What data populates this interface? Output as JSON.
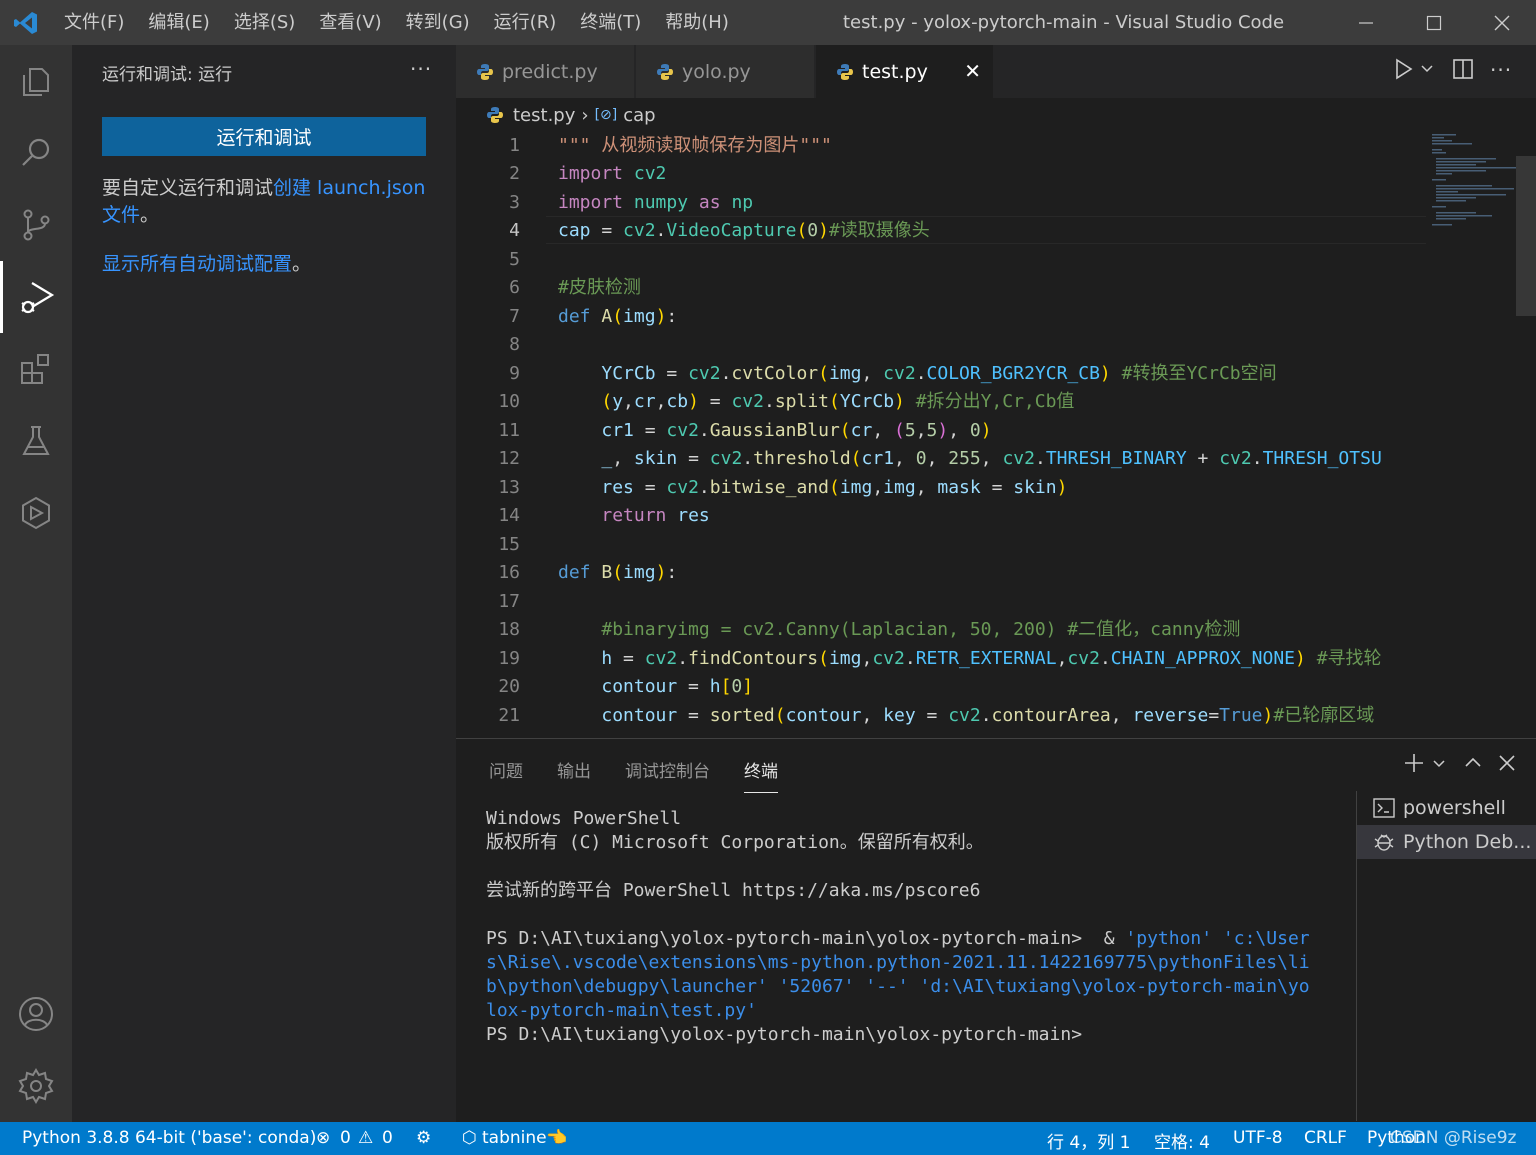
{
  "titlebar": {
    "menu": [
      "文件(F)",
      "编辑(E)",
      "选择(S)",
      "查看(V)",
      "转到(G)",
      "运行(R)",
      "终端(T)",
      "帮助(H)"
    ],
    "window_title": "test.py - yolox-pytorch-main - Visual Studio Code"
  },
  "sidebar": {
    "header": "运行和调试: 运行",
    "run_button": "运行和调试",
    "para_prefix": "要自定义运行和调试",
    "para_link": "创建 launch.json",
    "para_link2": "文件",
    "para_suffix": "。",
    "show_all": "显示所有自动调试配置",
    "show_all_suffix": "。"
  },
  "tabs": [
    {
      "label": "predict.py"
    },
    {
      "label": "yolo.py"
    },
    {
      "label": "test.py"
    }
  ],
  "breadcrumb": {
    "file": "test.py",
    "symbol": "cap"
  },
  "editor": {
    "current_line": 4,
    "line_numbers": [
      "1",
      "2",
      "3",
      "4",
      "5",
      "6",
      "7",
      "8",
      "9",
      "10",
      "11",
      "12",
      "13",
      "14",
      "15",
      "16",
      "17",
      "18",
      "19",
      "20",
      "21"
    ]
  },
  "panel": {
    "tabs": [
      "问题",
      "输出",
      "调试控制台",
      "终端"
    ],
    "terminal": {
      "l1": "Windows PowerShell",
      "l2": "版权所有 (C) Microsoft Corporation。保留所有权利。",
      "l3": "尝试新的跨平台 PowerShell https://aka.ms/pscore6",
      "l4_prompt": "PS D:\\AI\\tuxiang\\yolox-pytorch-main\\yolox-pytorch-main>  & ",
      "l4_cmd": "'python' 'c:\\User",
      "l5": "s\\Rise\\.vscode\\extensions\\ms-python.python-2021.11.1422169775\\pythonFiles\\li",
      "l6": "b\\python\\debugpy\\launcher' '52067' '--' 'd:\\AI\\tuxiang\\yolox-pytorch-main\\yo",
      "l7": "lox-pytorch-main\\test.py'",
      "l8": "PS D:\\AI\\tuxiang\\yolox-pytorch-main\\yolox-pytorch-main>"
    },
    "terminal_list": [
      "powershell",
      "Python Deb..."
    ]
  },
  "statusbar": {
    "interpreter": "Python 3.8.8 64-bit ('base': conda)",
    "errors": "0",
    "warnings": "0",
    "tabnine": "tabnine",
    "position": "行 4，列 1",
    "spaces": "空格: 4",
    "encoding": "UTF-8",
    "eol": "CRLF",
    "language": "Python",
    "watermark": "CSDN @Rise9z"
  },
  "colors": {
    "accent": "#007acc",
    "button": "#0e639c",
    "link": "#3794ff"
  }
}
